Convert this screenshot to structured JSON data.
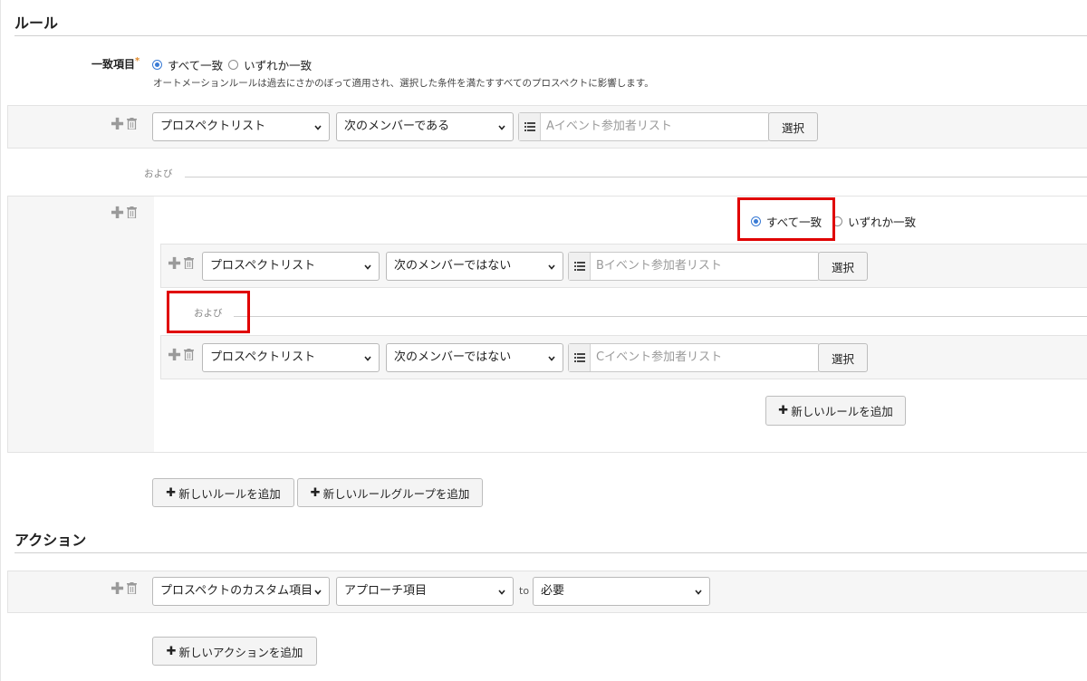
{
  "rules_section": {
    "title": "ルール",
    "match_label": "一致項目",
    "required_mark": "*",
    "match_options": [
      "すべて一致",
      "いずれか一致"
    ],
    "match_selected": "すべて一致",
    "note": "オートメーションルールは過去にさかのぼって適用され、選択した条件を満たすすべてのプロスペクトに影響します。",
    "rule1": {
      "field": "プロスペクトリスト",
      "operator": "次のメンバーである",
      "list_placeholder": "Aイベント参加者リスト",
      "select_button": "選択"
    },
    "and_label": "および",
    "group": {
      "match_options": [
        "すべて一致",
        "いずれか一致"
      ],
      "match_selected": "すべて一致",
      "rule1": {
        "field": "プロスペクトリスト",
        "operator": "次のメンバーではない",
        "list_placeholder": "Bイベント参加者リスト",
        "select_button": "選択"
      },
      "and_label": "および",
      "rule2": {
        "field": "プロスペクトリスト",
        "operator": "次のメンバーではない",
        "list_placeholder": "Cイベント参加者リスト",
        "select_button": "選択"
      },
      "add_rule_button": "新しいルールを追加"
    },
    "add_rule_button": "新しいルールを追加",
    "add_group_button": "新しいルールグループを追加"
  },
  "actions_section": {
    "title": "アクション",
    "action1": {
      "type": "プロスペクトのカスタム項目",
      "field": "アプローチ項目",
      "to_label": "to",
      "value": "必要"
    },
    "add_action_button": "新しいアクションを追加"
  },
  "colors": {
    "highlight": "#e00000",
    "radio_accent": "#3a7bd5",
    "band_bg": "#f6f6f6"
  }
}
